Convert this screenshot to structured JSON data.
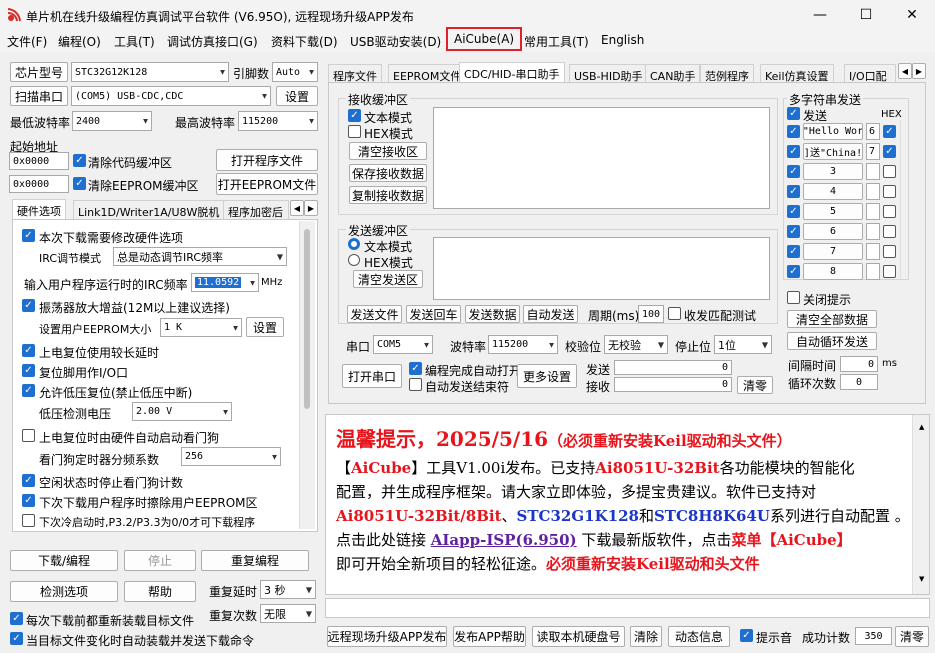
{
  "window": {
    "title": "单片机在线升级编程仿真调试平台软件 (V6.95O), 远程现场升级APP发布",
    "min": "—",
    "max": "☐",
    "close": "✕"
  },
  "menu": [
    "文件(F)",
    "编程(O)",
    "工具(T)",
    "调试仿真接口(G)",
    "资料下载(D)",
    "USB驱动安装(D)",
    "AiCube(A)",
    "常用工具(T)",
    "English"
  ],
  "left": {
    "chip_btn": "芯片型号",
    "chip_value": "STC32G12K128",
    "pin_label": "引脚数",
    "pin_value": "Auto",
    "scan_btn": "扫描串口",
    "port_value": "(COM5) USB-CDC,CDC",
    "settings_btn": "设置",
    "min_baud_label": "最低波特率",
    "min_baud": "2400",
    "max_baud_label": "最高波特率",
    "max_baud": "115200",
    "start_addr_label": "起始地址",
    "addr1": "0x0000",
    "clear_code": "清除代码缓冲区",
    "open_prog": "打开程序文件",
    "addr2": "0x0000",
    "clear_eeprom": "清除EEPROM缓冲区",
    "open_eeprom": "打开EEPROM文件",
    "tabs": [
      "硬件选项",
      "Link1D/Writer1A/U8W脱机",
      "程序加密后"
    ],
    "hw": {
      "modify_hw": "本次下载需要修改硬件选项",
      "irc_mode_label": "IRC调节模式",
      "irc_mode": "总是动态调节IRC频率",
      "irc_freq_label": "输入用户程序运行时的IRC频率",
      "irc_freq": "11.0592",
      "mhz": "MHz",
      "osc_gain": "振荡器放大增益(12M以上建议选择)",
      "eeprom_size_label": "设置用户EEPROM大小",
      "eeprom_size": "1 K",
      "eeprom_set": "设置",
      "long_reset": "上电复位使用较长延时",
      "reset_io": "复位脚用作I/O口",
      "lvr": "允许低压复位(禁止低压中断)",
      "lvd_label": "低压检测电压",
      "lvd": "2.00 V",
      "wdt_auto": "上电复位时由硬件自动启动看门狗",
      "wdt_div_label": "看门狗定时器分频系数",
      "wdt_div": "256",
      "idle_wdt": "空闲状态时停止看门狗计数",
      "erase_eeprom": "下次下载用户程序时擦除用户EEPROM区",
      "p32_p33": "下次冷启动时,P3.2/P3.3为0/0才可下载程序"
    },
    "download_btn": "下载/编程",
    "stop_btn": "停止",
    "reprog_btn": "重复编程",
    "check_btn": "检测选项",
    "help_btn": "帮助",
    "repeat_delay_label": "重复延时",
    "repeat_delay": "3 秒",
    "repeat_count_label": "重复次数",
    "repeat_count": "无限",
    "reload_each": "每次下载前都重新装载目标文件",
    "auto_reload": "当目标文件变化时自动装载并发送下载命令"
  },
  "right": {
    "tabs": [
      "程序文件",
      "EEPROM文件",
      "CDC/HID-串口助手",
      "USB-HID助手",
      "CAN助手",
      "范例程序",
      "Keil仿真设置",
      "I/O口配"
    ],
    "recv": {
      "title": "接收缓冲区",
      "text_mode": "文本模式",
      "hex_mode": "HEX模式",
      "clear": "清空接收区",
      "save": "保存接收数据",
      "copy": "复制接收数据"
    },
    "send": {
      "title": "发送缓冲区",
      "text_mode": "文本模式",
      "hex_mode": "HEX模式",
      "clear": "清空发送区",
      "send_file": "发送文件",
      "send_cr": "发送回车",
      "send_data": "发送数据",
      "auto_send": "自动发送",
      "period_label": "周期(ms)",
      "period": "100",
      "match": "收发匹配测试"
    },
    "multi": {
      "title": "多字符串发送",
      "send_label": "发送",
      "hex_label": "HEX",
      "rows": [
        {
          "text": "\"Hello Wor",
          "num": "6",
          "hex": true
        },
        {
          "text": "]送\"China!",
          "num": "7",
          "hex": true
        },
        {
          "text": "3",
          "num": "",
          "hex": false
        },
        {
          "text": "4",
          "num": "",
          "hex": false
        },
        {
          "text": "5",
          "num": "",
          "hex": false
        },
        {
          "text": "6",
          "num": "",
          "hex": false
        },
        {
          "text": "7",
          "num": "",
          "hex": false
        },
        {
          "text": "8",
          "num": "",
          "hex": false
        }
      ],
      "close_tip": "关闭提示",
      "clear_all": "清空全部数据",
      "auto_loop": "自动循环发送",
      "interval_label": "间隔时间",
      "interval": "0",
      "ms": "ms",
      "loop_label": "循环次数",
      "loop": "0"
    },
    "port_label": "串口",
    "port": "COM5",
    "baud_label": "波特率",
    "baud": "115200",
    "parity_label": "校验位",
    "parity": "无校验",
    "stop_label": "停止位",
    "stop": "1位",
    "open_port": "打开串口",
    "auto_open": "编程完成自动打开",
    "auto_end": "自动发送结束符",
    "more": "更多设置",
    "tx_label": "发送",
    "tx": "0",
    "rx_label": "接收",
    "rx": "0",
    "clear_cnt": "清零"
  },
  "notice": {
    "title": "温馨提示，2025/5/16",
    "title_note": "（必须重新安装Keil驱动和头文件）",
    "l1a": "【",
    "l1b": "AiCube",
    "l1c": "】工具V1.00i发布。已支持",
    "l1d": "Ai8051U-32Bit",
    "l1e": "各功能模块的智能化",
    "l2": "配置，并生成程序框架。请大家立即体验，多提宝贵建议。软件已支持对",
    "l3a": "Ai8051U-32Bit/8Bit",
    "l3b": "、",
    "l3c": "STC32G1K128",
    "l3d": "和",
    "l3e": "STC8H8K64U",
    "l3f": "系列进行自动配置 。",
    "l4a": "点击此处链接 ",
    "l4b": "AIapp-ISP(6.950)",
    "l4c": " 下载最新版软件，点击",
    "l4d": "菜单【",
    "l4e": "AiCube",
    "l4f": "】",
    "l5a": "即可开始全新项目的轻松征途。",
    "l5b": "必须重新安装Keil驱动和头文件"
  },
  "bottom": {
    "remote": "远程现场升级APP发布",
    "publish_help": "发布APP帮助",
    "read_disk": "读取本机硬盘号",
    "clear": "清除",
    "dyn_info": "动态信息",
    "beep": "提示音",
    "success_label": "成功计数",
    "success": "350",
    "reset": "清零"
  },
  "colors": {
    "accent": "#1e6fd0",
    "highlight": "#e0202a"
  }
}
